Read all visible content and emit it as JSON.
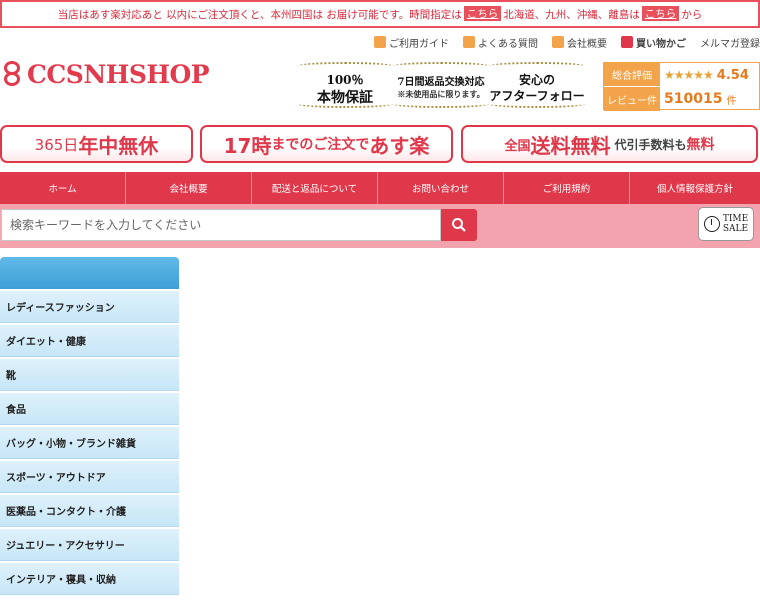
{
  "notice": {
    "part1": "当店はあす楽対応あと 以内にご注文頂くと、本州四国は お届け可能です。時間指定は",
    "link1": "こちら",
    "part2": "北海道、九州、沖縄、離島は",
    "link2": "こちら",
    "part3": "から"
  },
  "toplinks": [
    {
      "label": "ご利用ガイド",
      "icon": "guide-icon",
      "color": "#f3a34a"
    },
    {
      "label": "よくある質問",
      "icon": "question-icon",
      "color": "#f3a34a"
    },
    {
      "label": "会社概要",
      "icon": "building-icon",
      "color": "#f3a34a"
    },
    {
      "label": "買い物かご",
      "icon": "cart-icon",
      "color": "#e0384b"
    },
    {
      "label": "メルマガ登録",
      "icon": "",
      "color": ""
    }
  ],
  "logo": {
    "text": "CCSNHSHOP"
  },
  "badges": [
    {
      "line1": "100％",
      "line2": "本物保証"
    },
    {
      "line1": "7日間返品交換対応",
      "line2": "※未使用品に限ります。"
    },
    {
      "line1": "安心の",
      "line2": "アフターフォロー"
    }
  ],
  "rating": {
    "label1": "総合評価",
    "stars": "★★★★★",
    "score": "4.54",
    "label2": "レビュー件",
    "count": "510015",
    "unit": "件"
  },
  "banners": {
    "b1": {
      "a": "365日",
      "b": "年中無休"
    },
    "b2": {
      "a": "17時",
      "b": "までのご注文で",
      "c": "あす楽"
    },
    "b3": {
      "a": "全国",
      "b": "送料無料",
      "c": "代引手数料",
      "d": "も",
      "e": "無料"
    }
  },
  "nav": [
    {
      "label": "ホーム",
      "width": 126
    },
    {
      "label": "会社概要",
      "width": 126
    },
    {
      "label": "配送と返品について",
      "width": 126
    },
    {
      "label": "お問い合わせ",
      "width": 126
    },
    {
      "label": "ご利用規約",
      "width": 126
    },
    {
      "label": "個人情報保護方針",
      "width": 130
    }
  ],
  "search": {
    "placeholder": "検索キーワードを入力してください"
  },
  "timesale": {
    "line1": "TIME",
    "line2": "SALE"
  },
  "sidebar": {
    "items": [
      "レディースファッション",
      "ダイエット・健康",
      "靴",
      "食品",
      "バッグ・小物・ブランド雑貨",
      "スポーツ・アウトドア",
      "医薬品・コンタクト・介護",
      "ジュエリー・アクセサリー",
      "インテリア・寝具・収納"
    ]
  },
  "colors": {
    "accent": "#e0384b",
    "orange": "#f3a34a",
    "sidebar": "#c7e6f7"
  }
}
